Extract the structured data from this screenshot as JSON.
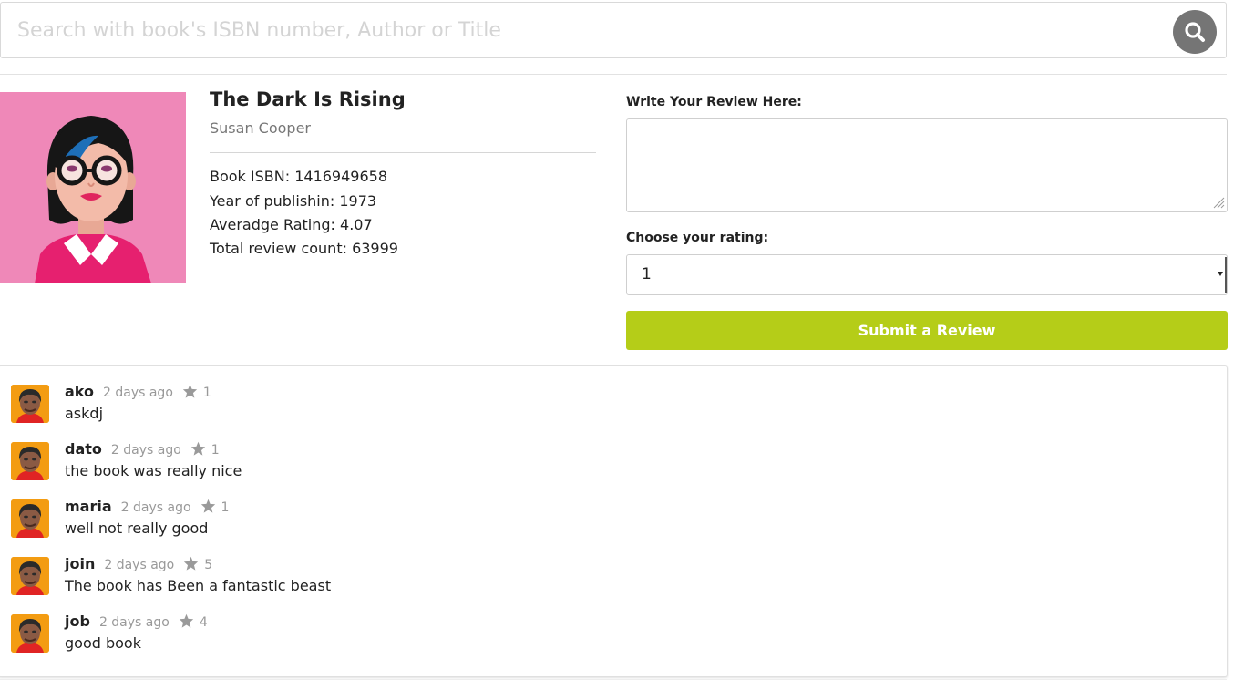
{
  "search": {
    "placeholder": "Search with book's ISBN number, Author or Title",
    "icon": "search-icon"
  },
  "book": {
    "title": "The Dark Is Rising",
    "author": "Susan Cooper",
    "cover_icon": "avatar-woman-glasses",
    "isbn_line": "Book ISBN: 1416949658",
    "year_line": "Year of publishin: 1973",
    "rating_line": "Averadge Rating: 4.07",
    "count_line": "Total review count: 63999"
  },
  "review_form": {
    "textarea_label": "Write Your Review Here:",
    "textarea_value": "",
    "rating_label": "Choose your rating:",
    "rating_selected": "1",
    "submit_label": "Submit a Review",
    "submit_color": "#b5cd18"
  },
  "reviews": [
    {
      "user": "ako",
      "date": "2 days ago",
      "rating": "1",
      "text": "askdj"
    },
    {
      "user": "dato",
      "date": "2 days ago",
      "rating": "1",
      "text": "the book was really nice"
    },
    {
      "user": "maria",
      "date": "2 days ago",
      "rating": "1",
      "text": "well not really good"
    },
    {
      "user": "join",
      "date": "2 days ago",
      "rating": "5",
      "text": "The book has Been a fantastic beast"
    },
    {
      "user": "job",
      "date": "2 days ago",
      "rating": "4",
      "text": "good book"
    }
  ],
  "review_icons": {
    "avatar": "user-avatar-icon",
    "star": "star-icon"
  }
}
